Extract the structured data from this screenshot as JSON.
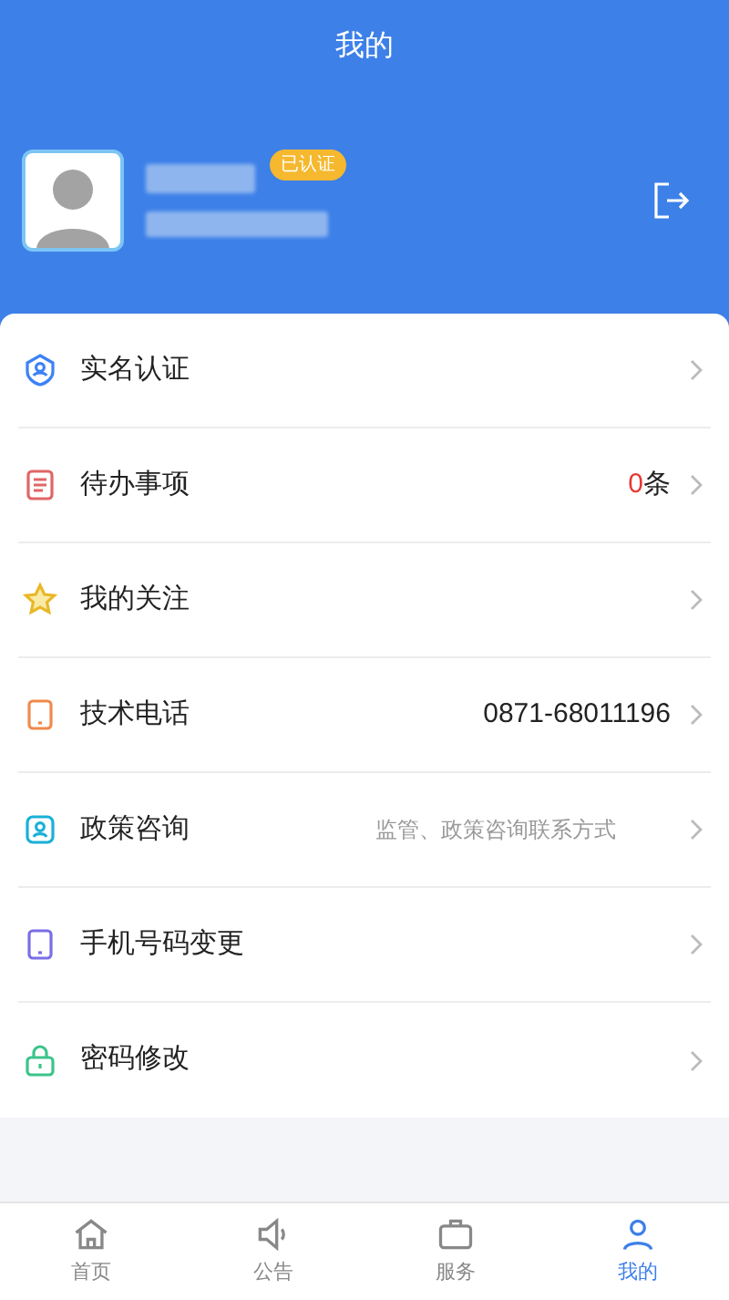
{
  "header": {
    "title": "我的"
  },
  "profile": {
    "badge": "已认证"
  },
  "menu": [
    {
      "label": "实名认证"
    },
    {
      "label": "待办事项",
      "count": "0",
      "unit": "条"
    },
    {
      "label": "我的关注"
    },
    {
      "label": "技术电话",
      "value": "0871-68011196"
    },
    {
      "label": "政策咨询",
      "hint": "监管、政策咨询联系方式"
    },
    {
      "label": "手机号码变更"
    },
    {
      "label": "密码修改"
    }
  ],
  "tabs": [
    {
      "label": "首页",
      "selected": false
    },
    {
      "label": "公告",
      "selected": false
    },
    {
      "label": "服务",
      "selected": false
    },
    {
      "label": "我的",
      "selected": true
    }
  ]
}
